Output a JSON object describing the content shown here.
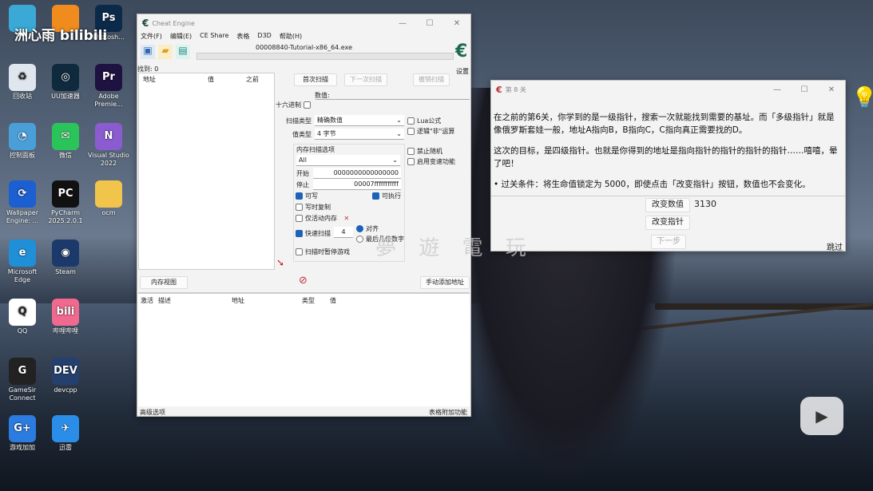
{
  "watermark": {
    "top_left": "洲心雨 bilibili",
    "center": "夢 遊 電 玩"
  },
  "desktop_icons": [
    {
      "label": "",
      "glyph": "",
      "color": "#3aa9d6"
    },
    {
      "label": "回收站",
      "glyph": "♻",
      "color": "#dfe6ee"
    },
    {
      "label": "控制面板",
      "glyph": "◔",
      "color": "#4a9fd8"
    },
    {
      "label": "Wallpaper Engine: ...",
      "glyph": "⟳",
      "color": "#1b5fd0"
    },
    {
      "label": "Microsoft Edge",
      "glyph": "e",
      "color": "#1f8fd8"
    },
    {
      "label": "QQ",
      "glyph": "Q",
      "color": "#ffffff"
    },
    {
      "label": "GameSir Connect",
      "glyph": "G",
      "color": "#222"
    },
    {
      "label": "游戏加加",
      "glyph": "G+",
      "color": "#2c7be0"
    },
    {
      "label": "",
      "glyph": "",
      "color": "#f08c1e"
    },
    {
      "label": "UU加速器",
      "glyph": "◎",
      "color": "#0f2a3c"
    },
    {
      "label": "微信",
      "glyph": "✉",
      "color": "#2bc45a"
    },
    {
      "label": "PyCharm 2025.2.0.1",
      "glyph": "PC",
      "color": "#111"
    },
    {
      "label": "Steam",
      "glyph": "◉",
      "color": "#1b3a6b"
    },
    {
      "label": "哔哩哔哩",
      "glyph": "bili",
      "color": "#f0698f"
    },
    {
      "label": "devcpp",
      "glyph": "DEV",
      "color": "#25406e"
    },
    {
      "label": "迅雷",
      "glyph": "✈",
      "color": "#2a8ee8"
    },
    {
      "label": "Photosh...",
      "glyph": "Ps",
      "color": "#0b2a4a"
    },
    {
      "label": "Adobe Premie...",
      "glyph": "Pr",
      "color": "#1d1240"
    },
    {
      "label": "Visual Studio 2022",
      "glyph": "N",
      "color": "#8a5cd0"
    },
    {
      "label": "ocm",
      "glyph": "",
      "color": "#f1c44c"
    }
  ],
  "ce": {
    "title": "Cheat Engine",
    "menu": [
      "文件(F)",
      "编辑(E)",
      "CE Share",
      "表格",
      "D3D",
      "帮助(H)"
    ],
    "process": "00008840-Tutorial-x86_64.exe",
    "settings": "设置",
    "found": "找到: 0",
    "list_headers": [
      "地址",
      "值",
      "之前"
    ],
    "first_scan": "首次扫描",
    "next_scan": "下一次扫描",
    "undo_scan": "撤销扫描",
    "value_label": "数值:",
    "hex_label": "十六进制",
    "value": "",
    "scan_type_label": "扫描类型",
    "scan_type": "精确数值",
    "value_type_label": "值类型",
    "value_type": "4 字节",
    "lua": "Lua公式",
    "not_op": "逻辑\"非\"运算",
    "no_random": "禁止随机",
    "speedhack": "启用变速功能",
    "mem_options": "内存扫描选项",
    "mem_region": "All",
    "start_label": "开始",
    "start": "0000000000000000",
    "stop_label": "停止",
    "stop": "00007fffffffffff",
    "writable": "可写",
    "executable": "可执行",
    "copy_on_write": "写时复制",
    "active_only": "仅活动内存",
    "fast_scan": "快速扫描",
    "fast_value": "4",
    "align": "对齐",
    "last_digits": "最后几位数字",
    "pause": "扫描时暂停游戏",
    "memory_view": "内存视图",
    "add_address": "手动添加地址",
    "table_headers": [
      "激活",
      "描述",
      "地址",
      "类型",
      "值"
    ],
    "advanced": "高级选项",
    "table_extras": "表格附加功能"
  },
  "tut": {
    "title": "第 8 关",
    "p1": "在之前的第6关，你学到的是一级指针，搜索一次就能找到需要的基址。而「多级指针」就是像俄罗斯套娃一般，地址A指向B，B指向C，C指向真正需要找的D。",
    "p2": "这次的目标，是四级指针。也就是你得到的地址是指向指针的指针的指针的指针……嘻嘻，晕了吧！",
    "p3": "• 过关条件：将生命值锁定为 5000，即使点击「改变指针」按钮，数值也不会变化。",
    "change_value": "改变数值",
    "value": "3130",
    "change_pointer": "改变指针",
    "next": "下一步",
    "skip": "跳过"
  }
}
